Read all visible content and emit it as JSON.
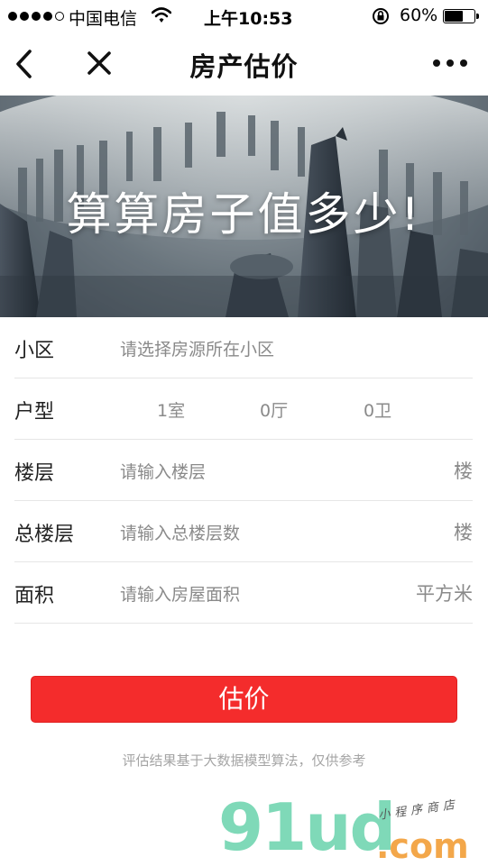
{
  "status_bar": {
    "carrier": "中国电信",
    "time": "上午10:53",
    "battery": "60%",
    "battery_fraction": 0.6
  },
  "nav": {
    "title": "房产估价",
    "back_icon": "chevron-left-icon",
    "close_icon": "close-icon",
    "more_icon": "more-dots-icon"
  },
  "banner": {
    "headline": "算算房子值多少!"
  },
  "form": {
    "community": {
      "label": "小区",
      "placeholder": "请选择房源所在小区"
    },
    "layout": {
      "label": "户型",
      "rooms": "1室",
      "halls": "0厅",
      "baths": "0卫"
    },
    "floor": {
      "label": "楼层",
      "placeholder": "请输入楼层",
      "unit": "楼"
    },
    "total_floors": {
      "label": "总楼层",
      "placeholder": "请输入总楼层数",
      "unit": "楼"
    },
    "area": {
      "label": "面积",
      "placeholder": "请输入房屋面积",
      "unit": "平方米"
    }
  },
  "submit_label": "估价",
  "disclaimer": "评估结果基于大数据模型算法，仅供参考",
  "watermark": {
    "main": "91ud",
    "domain": ".com",
    "tagline": "小程序商店"
  },
  "colors": {
    "accent_red": "#f42c2c",
    "watermark_green": "#7fd9b8",
    "watermark_orange": "#f3a74a"
  }
}
